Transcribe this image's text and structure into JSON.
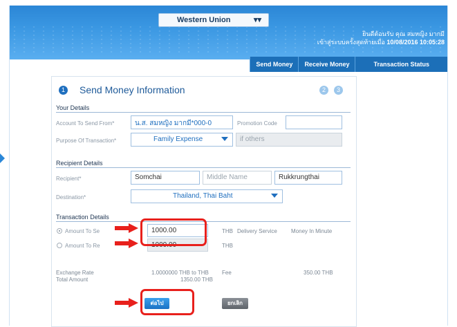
{
  "top": {
    "service_select": "Western Union",
    "user_line1": "ยินดีต้อนรับ คุณ สมหญิง มากมี",
    "user_line2_prefix": "เข้าสู่ระบบครั้งสุดท้ายเมื่อ",
    "user_line2_datetime": "10/08/2016 10:05:28"
  },
  "tabs": [
    "Send Money",
    "Receive Money",
    "Transaction Status"
  ],
  "panel": {
    "step_current": "1",
    "title": "Send Money Information",
    "step_others": [
      "2",
      "3"
    ]
  },
  "your_details": {
    "section": "Your Details",
    "account_label": "Account To Send From*",
    "account_value": "น.ส. สมหญิง มากมี*000-0",
    "promo_label": "Promotion Code",
    "promo_value": "",
    "purpose_label": "Purpose Of Transaction*",
    "purpose_value": "Family Expense",
    "other_placeholder": "if others"
  },
  "recipient_details": {
    "section": "Recipient Details",
    "recipient_label": "Recipient*",
    "first_name": "Somchai",
    "middle_placeholder": "Middle Name",
    "last_name": "Rukkrungthai",
    "destination_label": "Destination*",
    "destination_value": "Thailand, Thai Baht"
  },
  "transaction_details": {
    "section": "Transaction Details",
    "amount_send_label": "Amount To Se",
    "amount_send_value": "1000.00",
    "amount_send_currency": "THB",
    "delivery_label": "Delivery Service",
    "delivery_value": "Money In Minute",
    "amount_receive_label": "Amount To Re",
    "amount_receive_value": "1000.00",
    "amount_receive_currency": "THB",
    "exchange_label": "Exchange Rate",
    "exchange_value": "1.0000000 THB to THB",
    "fee_label": "Fee",
    "fee_value": "350.00 THB",
    "total_label": "Total Amount",
    "total_value": "1350.00 THB"
  },
  "buttons": {
    "next": "ต่อไป",
    "cancel": "ยกเลิก"
  },
  "colors": {
    "header_blue": "#2b86d6",
    "title_blue": "#1e5a99",
    "highlight_red": "#e8201c"
  }
}
